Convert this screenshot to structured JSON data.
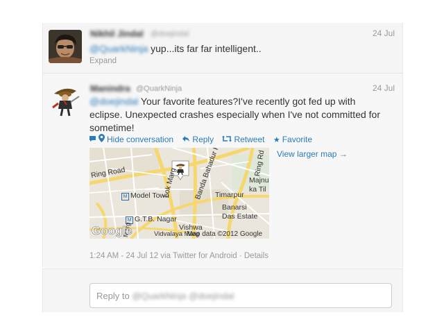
{
  "tweet1": {
    "name": "Nikhil Jindal",
    "handle": "@doejindal",
    "date": "24 Jul",
    "mention": "@QuarkNinja",
    "text": " yup...its far far intelligent..",
    "expand": "Expand"
  },
  "tweet2": {
    "name": "Manindra",
    "handle": "@QuarkNinja",
    "date": "24 Jul",
    "mention": "@doejindal",
    "text_line1": " Your favorite features?I've recently got fed up with",
    "text_line2": "eclipse. Unexpected crashes especially when I've not committed for",
    "text_line3": "sometime!",
    "actions": {
      "hide": "Hide conversation",
      "reply": "Reply",
      "retweet": "Retweet",
      "favorite": "Favorite"
    },
    "view_larger_map": "View larger map →",
    "map": {
      "labels": {
        "ring_road_left": "Ring Road",
        "model_town": "Model Town",
        "lok_marg": "Lok Marg",
        "banda": "Banda Bahadur Rd",
        "ring_rd_right": "Ring Rd",
        "majnu": "Majnu",
        "ka_til": "ka Til",
        "timarpur": "Timarpur",
        "banarsi": "Banarsi",
        "das_estate": "Das Estate",
        "gtb": "G.T.B. Nagar",
        "vishwa": "Vishwa",
        "vidvalaya": "Vidvalaya Marg",
        "marg_left": "Marg",
        "google": "Google",
        "copyright": "Map data ©2012 Google"
      }
    },
    "meta": "1:24 AM - 24 Jul 12 via Twitter for Android · Details"
  },
  "reply": {
    "prefix": "Reply to ",
    "mention1": "@QuarkNinja",
    "mention2": "@doejindal"
  }
}
